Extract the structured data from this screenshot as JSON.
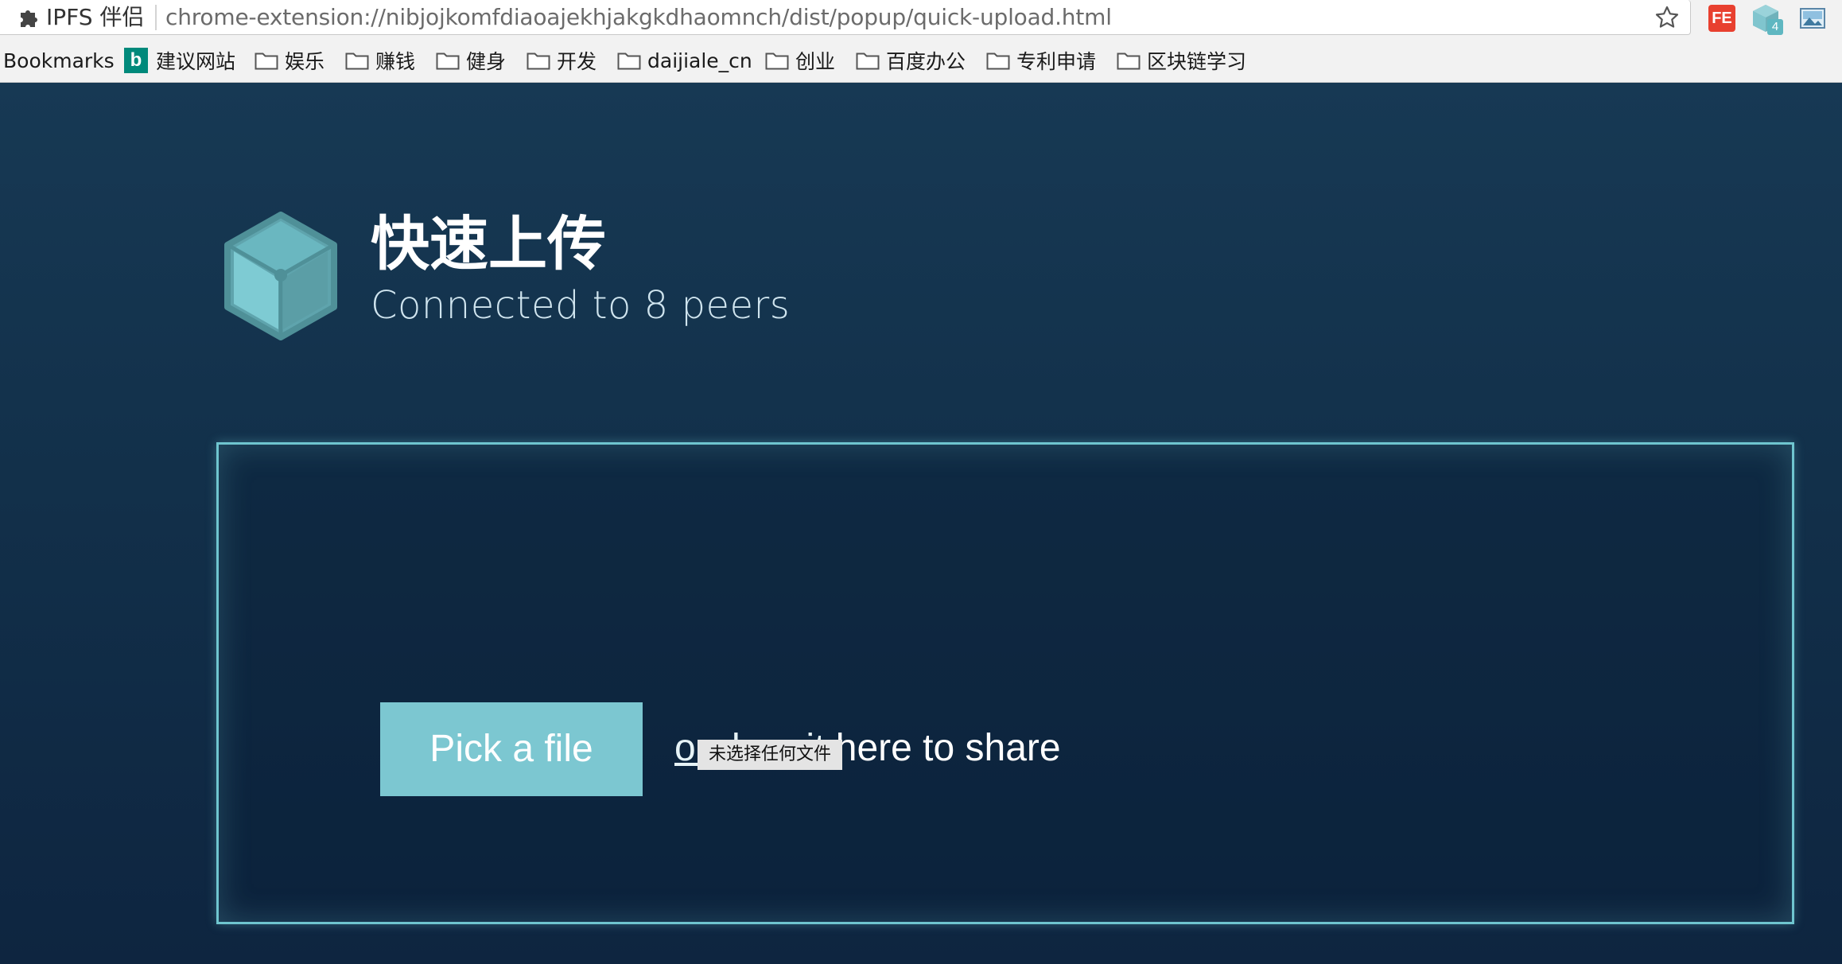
{
  "browser": {
    "site_label": "IPFS 伴侣",
    "url": "chrome-extension://nibjojkomfdiaoajekhjakgkdhaomnch/dist/popup/quick-upload.html",
    "icons": {
      "site": "puzzle-icon",
      "bookmark": "star-icon"
    },
    "extensions": {
      "fe_label": "FE",
      "ipfs_badge": "4"
    }
  },
  "bookmarks": {
    "label": "Bookmarks",
    "items": [
      {
        "label": "建议网站",
        "icon": "bing-icon"
      },
      {
        "label": "娱乐",
        "icon": "folder-icon"
      },
      {
        "label": "赚钱",
        "icon": "folder-icon"
      },
      {
        "label": "健身",
        "icon": "folder-icon"
      },
      {
        "label": "开发",
        "icon": "folder-icon"
      },
      {
        "label": "daijiale_cn",
        "icon": "folder-icon"
      },
      {
        "label": "创业",
        "icon": "folder-icon"
      },
      {
        "label": "百度办公",
        "icon": "folder-icon"
      },
      {
        "label": "专利申请",
        "icon": "folder-icon"
      },
      {
        "label": "区块链学习",
        "icon": "folder-icon"
      }
    ]
  },
  "header": {
    "title": "快速上传",
    "subtitle": "Connected to 8 peers"
  },
  "upload": {
    "pick_button": "Pick a file",
    "drop_hint_lead": "or drop it",
    "drop_hint_rest": " here to share",
    "file_status": "未选择任何文件"
  },
  "colors": {
    "background": "#12304a",
    "accent": "#7cc7d1",
    "border": "#6fc5cf"
  }
}
